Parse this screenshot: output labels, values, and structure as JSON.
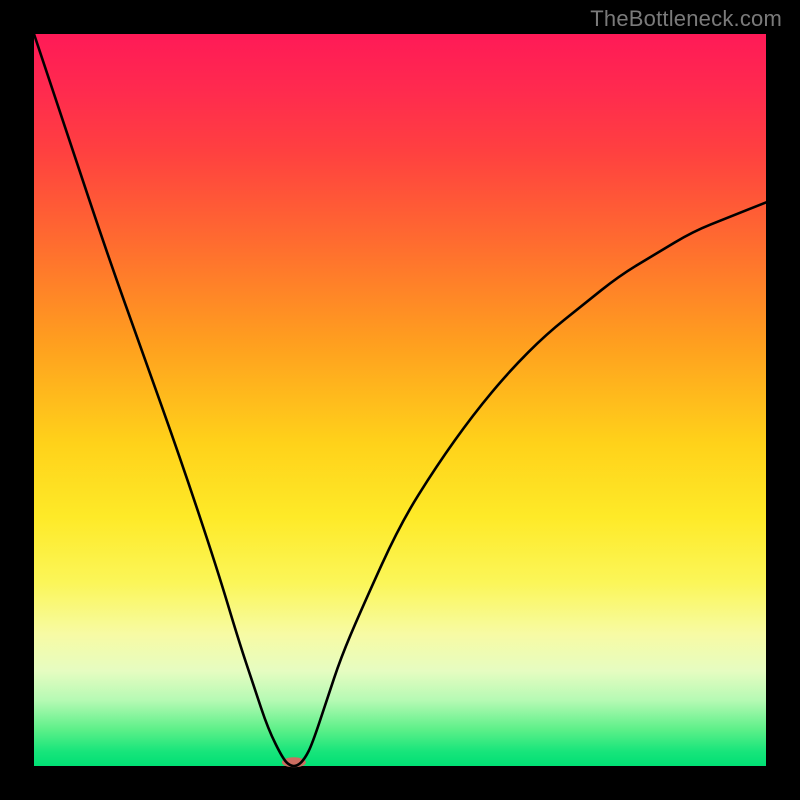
{
  "watermark": {
    "text": "TheBottleneck.com"
  },
  "chart_data": {
    "type": "line",
    "title": "",
    "xlabel": "",
    "ylabel": "",
    "xlim": [
      0,
      100
    ],
    "ylim": [
      0,
      100
    ],
    "grid": false,
    "legend": false,
    "series": [
      {
        "name": "bottleneck-curve",
        "x": [
          0,
          5,
          10,
          15,
          20,
          25,
          28,
          30,
          32,
          34,
          35,
          36,
          37,
          38,
          40,
          42,
          45,
          50,
          55,
          60,
          65,
          70,
          75,
          80,
          85,
          90,
          95,
          100
        ],
        "values": [
          100,
          85,
          70,
          56,
          42,
          27,
          17,
          11,
          5,
          1,
          0,
          0,
          1,
          3,
          9,
          15,
          22,
          33,
          41,
          48,
          54,
          59,
          63,
          67,
          70,
          73,
          75,
          77
        ]
      }
    ],
    "marker": {
      "x": 35.5,
      "y": 0.5,
      "color": "#cd6d61",
      "rx": 12,
      "ry": 5
    },
    "background_gradient": {
      "stops": [
        {
          "offset": 0.0,
          "color": "#ff1a57"
        },
        {
          "offset": 0.42,
          "color": "#ff9e1f"
        },
        {
          "offset": 0.66,
          "color": "#feea28"
        },
        {
          "offset": 0.87,
          "color": "#e6fcc1"
        },
        {
          "offset": 1.0,
          "color": "#00df74"
        }
      ]
    }
  }
}
